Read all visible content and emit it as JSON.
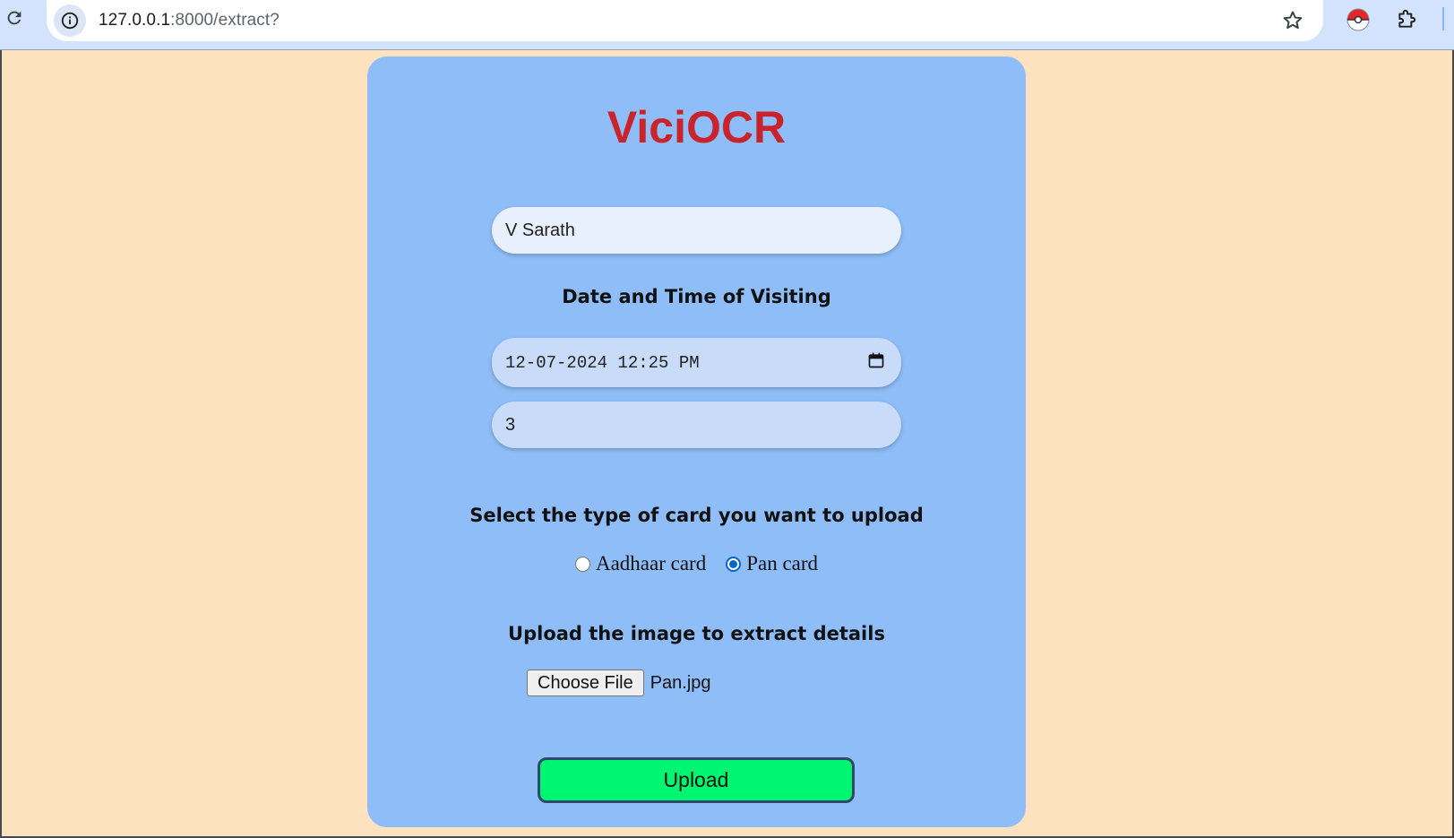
{
  "browser": {
    "url_host": "127.0.0.1",
    "url_path": ":8000/extract?"
  },
  "app": {
    "title": "ViciOCR"
  },
  "form": {
    "name_value": "V Sarath",
    "date_label": "Date and Time of Visiting",
    "datetime_value": "12-07-2024 12:25 PM",
    "count_value": "3",
    "card_type_label": "Select the type of card you want to upload",
    "card_options": [
      {
        "label": "Aadhaar card",
        "checked": false
      },
      {
        "label": "Pan card",
        "checked": true
      }
    ],
    "upload_label": "Upload the image to extract details",
    "choose_file_label": "Choose File",
    "file_name": "Pan.jpg",
    "submit_label": "Upload"
  },
  "colors": {
    "page_bg": "#fde2c0",
    "card_bg": "#8fbdf7",
    "title": "#c9242b",
    "upload_button": "#00f570",
    "radio_accent": "#0b63ce"
  },
  "icons": {
    "reload": "reload-icon",
    "site_info": "info-icon",
    "bookmark": "star-icon",
    "extension": "pokeball-icon",
    "extensions_menu": "puzzle-icon",
    "calendar": "calendar-icon"
  }
}
